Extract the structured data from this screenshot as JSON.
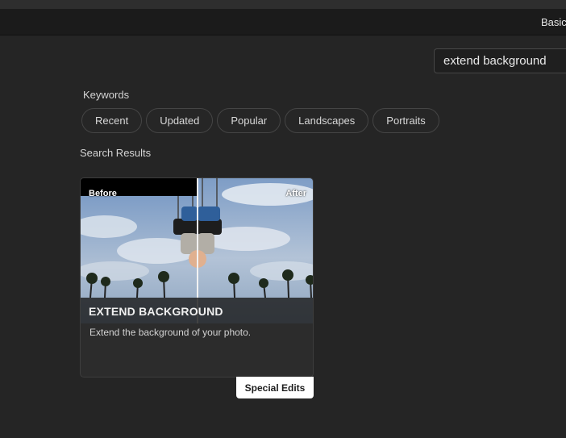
{
  "header": {
    "mode_tab_label": "Basic"
  },
  "search": {
    "value": "extend background"
  },
  "keywords": {
    "label": "Keywords",
    "pills": [
      "Recent",
      "Updated",
      "Popular",
      "Landscapes",
      "Portraits"
    ]
  },
  "results": {
    "label": "Search Results",
    "card": {
      "before_label": "Before",
      "after_label": "After",
      "title": "EXTEND BACKGROUND",
      "description": "Extend the background of your photo.",
      "badge": "Special Edits"
    }
  },
  "colors": {
    "background": "#252525",
    "topbar": "#1b1b1b",
    "badge_bg": "#ffffff"
  }
}
